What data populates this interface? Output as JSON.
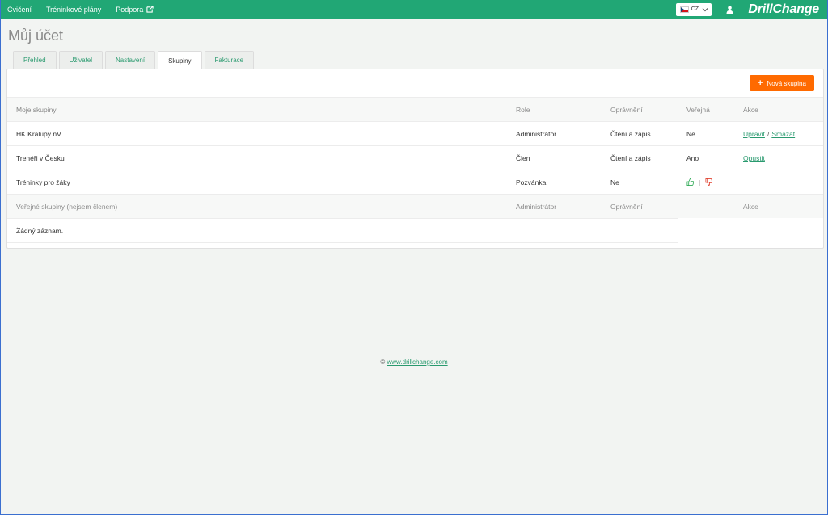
{
  "topbar": {
    "nav": [
      {
        "label": "Cvičení"
      },
      {
        "label": "Tréninkové plány"
      },
      {
        "label": "Podpora"
      }
    ],
    "language": "CZ",
    "brand": "DrillChange"
  },
  "page": {
    "title": "Můj účet"
  },
  "tabs": [
    {
      "label": "Přehled"
    },
    {
      "label": "Uživatel"
    },
    {
      "label": "Nastavení"
    },
    {
      "label": "Skupiny"
    },
    {
      "label": "Fakturace"
    }
  ],
  "active_tab": "Skupiny",
  "new_group_button": "Nová skupina",
  "my_groups": {
    "headers": {
      "name": "Moje skupiny",
      "role": "Role",
      "permission": "Oprávnění",
      "public": "Veřejná",
      "actions": "Akce"
    },
    "rows": [
      {
        "name": "HK Kralupy nV",
        "role": "Administrátor",
        "permission": "Čtení a zápis",
        "public": "Ne",
        "action1": "Upravit",
        "sep": "/",
        "action2": "Smazat"
      },
      {
        "name": "Trenéři v Česku",
        "role": "Člen",
        "permission": "Čtení a zápis",
        "public": "Ano",
        "action1": "Opustit"
      },
      {
        "name": "Tréninky pro žáky",
        "role": "Pozvánka",
        "permission": "Ne",
        "public_icons": [
          "thumbs-up-icon",
          "thumbs-down-icon"
        ],
        "public_sep": "|"
      }
    ]
  },
  "public_groups": {
    "headers": {
      "name": "Veřejné skupiny (nejsem členem)",
      "admin": "Administrátor",
      "permission": "Oprávnění",
      "actions": "Akce"
    },
    "empty_text": "Žádný záznam."
  },
  "footer": {
    "copyright": "©",
    "link": "www.drillchange.com"
  },
  "colors": {
    "topbar": "#21a775",
    "accent_button": "#ff6a00",
    "link": "#2a9a6f"
  }
}
